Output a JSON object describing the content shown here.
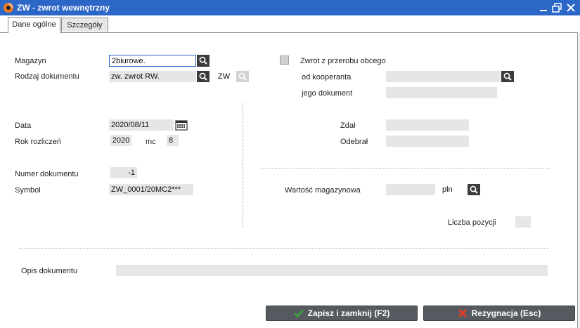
{
  "window": {
    "title": "ZW - zwrot wewnętrzny"
  },
  "tabs": [
    {
      "label": "Dane ogólne"
    },
    {
      "label": "Szczegóły"
    }
  ],
  "left": {
    "magazyn_label": "Magazyn",
    "magazyn_value": "2biurowe.",
    "rodzaj_label": "Rodzaj dokumentu",
    "rodzaj_value": "zw. zwrot RW.",
    "rodzaj_code": "ZW",
    "data_label": "Data",
    "data_value": "2020/08/11",
    "rok_label": "Rok rozliczeń",
    "rok_value": "2020",
    "mc_label": "mc",
    "mc_value": "8",
    "numer_label": "Numer dokumentu",
    "numer_value": "-1",
    "symbol_label": "Symbol",
    "symbol_value": "ZW_0001/20MC2***"
  },
  "right": {
    "zwrot_label": "Zwrot z przerobu obcego",
    "kooperant_label": "od kooperanta",
    "jego_label": "jego dokument",
    "zdal_label": "Zdał",
    "odebral_label": "Odebrał",
    "wartosc_label": "Wartość magazynowa",
    "currency": "pln",
    "liczba_label": "Liczba pozycji"
  },
  "opis_label": "Opis dokumentu",
  "buttons": {
    "save": "Zapisz i zamknij (F2)",
    "cancel": "Rezygnacja (Esc)"
  },
  "colors": {
    "titlebar": "#2c66c7",
    "field": "#e6e6e6",
    "button": "#555a60",
    "save_icon": "#3aa83a",
    "cancel_icon": "#e23a2a"
  }
}
